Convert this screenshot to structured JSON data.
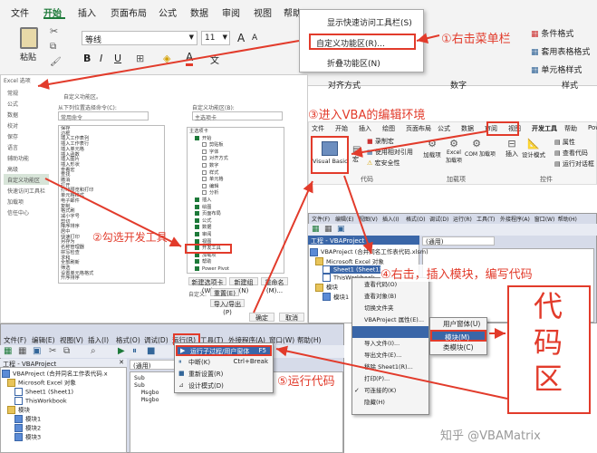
{
  "ribbon": {
    "tabs": [
      "文件",
      "开始",
      "插入",
      "页面布局",
      "公式",
      "数据",
      "审阅",
      "视图",
      "帮助"
    ],
    "active_tab": "开始",
    "paste": "粘贴",
    "font_name": "等线",
    "font_size": "11",
    "bold": "B",
    "italic": "I",
    "underline": "U",
    "font_glyph": "A",
    "wen_glyph": "文",
    "font_group_label": "字体",
    "align_group_label": "对齐方式",
    "number_group_label": "数字",
    "style_group_label": "样式",
    "style_items": [
      "条件格式",
      "套用表格格式",
      "单元格样式"
    ]
  },
  "context_menu": {
    "items": [
      "显示快速访问工具栏(S)",
      "自定义功能区(R)...",
      "折叠功能区(N)"
    ]
  },
  "steps": {
    "s1": "①右击菜单栏",
    "s2": "②勾选开发工具",
    "s3": "③进入VBA的编辑环境",
    "s4": "④右击，插入模块，编写代码",
    "s5": "⑤运行代码"
  },
  "options_dialog": {
    "title": "Excel 选项",
    "left_items": [
      "常规",
      "公式",
      "数据",
      "校对",
      "保存",
      "语言",
      "辅助功能",
      "高级",
      "自定义功能区",
      "快速访问工具栏",
      "加载项",
      "信任中心"
    ],
    "heading": "自定义功能区。",
    "choose_label": "从下列位置选择命令(C):",
    "choose_value": "常用命令",
    "customize_label": "自定义功能区(B):",
    "customize_value": "主选项卡",
    "commands": [
      "保存",
      "边框",
      "插入工作表列",
      "插入工作表行",
      "插入单元格",
      "插入函数",
      "插入图片",
      "插入形状",
      "查看宏",
      "查找",
      "撤消",
      "打开",
      "打印预览和打印",
      "单元格样式",
      "电子邮件",
      "复制",
      "格式刷",
      "减小字号",
      "剪切",
      "降序排序",
      "居中",
      "快速打印",
      "另存为",
      "名称管理器",
      "拼写检查",
      "求和",
      "全部刷新",
      "筛选",
      "设置单元格格式",
      "升序排序"
    ],
    "tree": [
      "主选项卡",
      "开始",
      "剪贴板",
      "字体",
      "对齐方式",
      "数字",
      "样式",
      "单元格",
      "编辑",
      "分析",
      "插入",
      "绘图",
      "页面布局",
      "公式",
      "数据",
      "审阅",
      "视图",
      "开发工具",
      "加载项",
      "帮助",
      "Power Pivot"
    ],
    "new_tab": "新建选项卡(W)",
    "new_group": "新建组(N)",
    "rename": "重命名(M)...",
    "custom_label": "自定义:",
    "reset": "重置(E)",
    "import_export": "导入/导出(P)",
    "ok": "确定",
    "cancel": "取消"
  },
  "dev_ribbon": {
    "tabs": [
      "文件",
      "开始",
      "插入",
      "绘图",
      "页面布局",
      "公式",
      "数据",
      "审阅",
      "视图",
      "开发工具",
      "帮助",
      "Power Pivot"
    ],
    "active_tab": "开发工具",
    "visual_basic": "Visual Basic",
    "macro": "宏",
    "record_macro": "录制宏",
    "relative_ref": "使用相对引用",
    "macro_security": "宏安全性",
    "code_group": "代码",
    "addins": "加载项",
    "excel_addins": "Excel 加载项",
    "com_addins": "COM 加载项",
    "addin_group": "加载项",
    "insert": "插入",
    "design_mode": "设计模式",
    "properties": "属性",
    "view_code": "查看代码",
    "run_dialog": "运行对话框",
    "controls_group": "控件"
  },
  "vbe_top": {
    "menus": [
      "文件(F)",
      "编辑(E)",
      "视图(V)",
      "插入(I)",
      "格式(O)",
      "调试(D)",
      "运行(R)",
      "工具(T)",
      "外接程序(A)",
      "窗口(W)",
      "帮助(H)"
    ],
    "project_title": "工程 - VBAProject",
    "general": "(通用)",
    "tree": [
      "VBAProject (合并同名工作表代码.xlsm)",
      "Microsoft Excel 对象",
      "Sheet1 (Sheet1)",
      "ThisWorkbook",
      "模块",
      "模块1"
    ]
  },
  "module_menu": {
    "items": [
      "查看代码(O)",
      "查看对象(B)",
      "切换文件夹",
      "VBAProject 属性(E)...",
      "插入(N)",
      "导入文件(I)...",
      "导出文件(E)...",
      "移除 Sheet1(R)...",
      "打印(P)...",
      "可连接的(K)",
      "隐藏(H)"
    ],
    "submenu": [
      "用户窗体(U)",
      "模块(M)",
      "类模块(C)"
    ]
  },
  "code_area": {
    "label": "代码区"
  },
  "vbe_bottom": {
    "menus": [
      "文件(F)",
      "编辑(E)",
      "视图(V)",
      "插入(I)",
      "格式(O)",
      "调试(D)",
      "运行(R)",
      "工具(T)",
      "外接程序(A)",
      "窗口(W)",
      "帮助(H)"
    ],
    "project_title": "工程 - VBAProject",
    "general": "(通用)",
    "code_lines": [
      "Sub",
      "Sub",
      "Msgbo",
      "Msgbo"
    ],
    "tree": [
      "VBAProject (合并同名工作表代码.x",
      "Microsoft Excel 对象",
      "Sheet1 (Sheet1)",
      "ThisWorkbook",
      "模块",
      "模块1",
      "模块2",
      "模块3"
    ]
  },
  "run_menu": {
    "items": [
      "运行子过程/用户窗体",
      "中断(K)",
      "重新设置(R)",
      "设计模式(D)"
    ],
    "shortcuts": [
      "F5",
      "Ctrl+Break",
      "",
      ""
    ]
  },
  "watermark": "知乎 @VBAMatrix",
  "colors": {
    "accent_red": "#e23b2b",
    "excel_green": "#1e7a3a",
    "vbe_bg": "#d6dbe9"
  }
}
